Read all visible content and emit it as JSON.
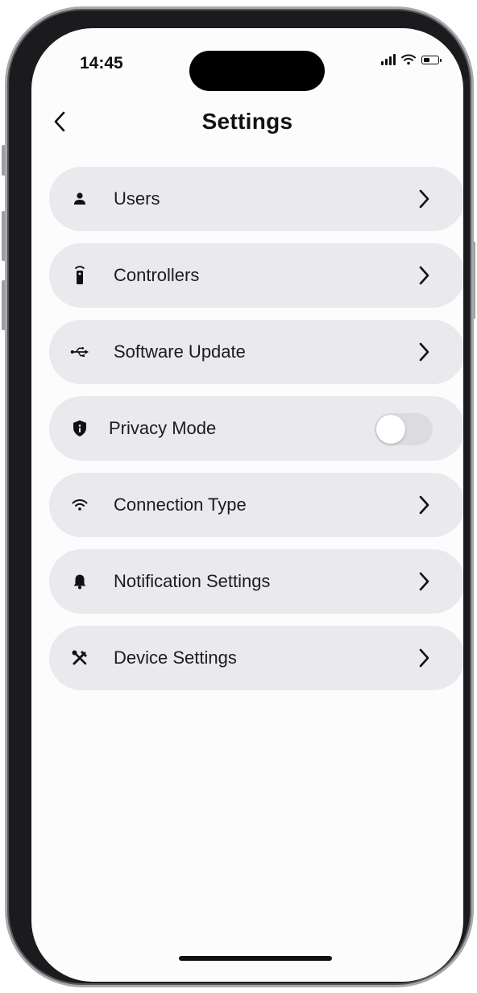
{
  "status_bar": {
    "time": "14:45",
    "battery_level": 0.45,
    "icons": [
      "cellular-signal-icon",
      "wifi-icon",
      "battery-icon"
    ]
  },
  "header": {
    "title": "Settings",
    "back_icon": "chevron-left-icon"
  },
  "settings": {
    "items": [
      {
        "label": "Users",
        "icon": "user-icon",
        "type": "link"
      },
      {
        "label": "Controllers",
        "icon": "remote-icon",
        "type": "link"
      },
      {
        "label": "Software Update",
        "icon": "usb-icon",
        "type": "link"
      },
      {
        "label": "Privacy Mode",
        "icon": "shield-icon",
        "type": "toggle",
        "value": false
      },
      {
        "label": "Connection Type",
        "icon": "wifi-icon",
        "type": "link"
      },
      {
        "label": "Notification Settings",
        "icon": "bell-icon",
        "type": "link"
      },
      {
        "label": "Device Settings",
        "icon": "tools-icon",
        "type": "link"
      }
    ]
  },
  "colors": {
    "row_background": "#e9e9ee",
    "screen_background": "#fcfcfd",
    "text": "#1c1c1e",
    "toggle_off": "#dcdce0"
  }
}
